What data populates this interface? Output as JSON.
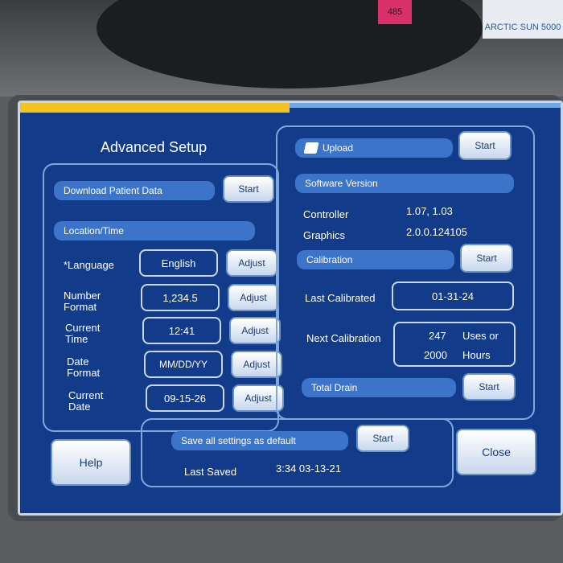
{
  "device": {
    "badge": "ARCTIC SUN 5000",
    "tag": "485"
  },
  "screen": {
    "title": "Advanced Setup",
    "download": {
      "label": "Download Patient Data",
      "button": "Start"
    },
    "location_time": {
      "label": "Location/Time"
    },
    "rows": [
      {
        "label": "*Language",
        "value": "English",
        "button": "Adjust"
      },
      {
        "label": "Number Format",
        "value": "1,234.5",
        "button": "Adjust"
      },
      {
        "label": "Current Time",
        "value": "12:41",
        "button": "Adjust"
      },
      {
        "label": "Date Format",
        "value": "MM/DD/YY",
        "button": "Adjust"
      },
      {
        "label": "Current Date",
        "value": "09-15-26",
        "button": "Adjust"
      }
    ],
    "upload": {
      "label": "Upload",
      "button": "Start"
    },
    "software": {
      "label": "Software Version",
      "controller_label": "Controller",
      "controller_value": "1.07, 1.03",
      "graphics_label": "Graphics",
      "graphics_value": "2.0.0.124105"
    },
    "calibration": {
      "label": "Calibration",
      "button": "Start",
      "last_label": "Last Calibrated",
      "last_value": "01-31-24",
      "next_label": "Next Calibration",
      "next_uses_value": "247",
      "next_uses_unit": "Uses or",
      "next_hours_value": "2000",
      "next_hours_unit": "Hours"
    },
    "drain": {
      "label": "Total Drain",
      "button": "Start"
    },
    "save": {
      "label": "Save all settings as default",
      "button": "Start",
      "last_saved_label": "Last Saved",
      "last_saved_value": "3:34 03-13-21"
    },
    "help_button": "Help",
    "close_button": "Close"
  }
}
